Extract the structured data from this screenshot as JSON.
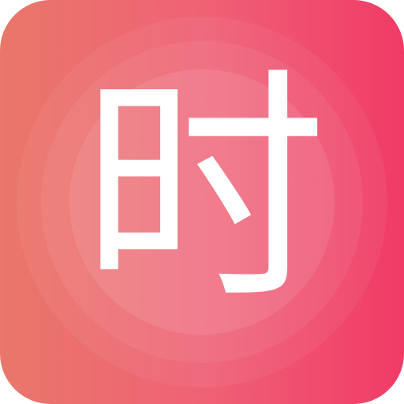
{
  "app_icon": {
    "glyph": "时",
    "glyph_color": "#ffffff",
    "gradient_colors": [
      "#e9776a",
      "#ef6275",
      "#f03b67"
    ]
  }
}
